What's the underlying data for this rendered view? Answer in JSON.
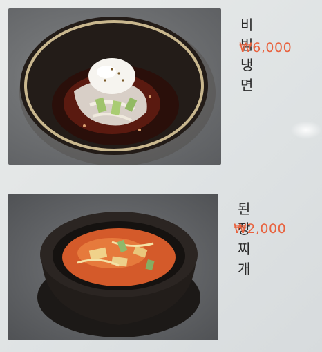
{
  "menu": {
    "items": [
      {
        "name": "비빔냉면",
        "price": "₩6,000",
        "photo_icon": "bibim-naengmyeon-photo"
      },
      {
        "name": "된장찌개",
        "price": "₩2,000",
        "photo_icon": "doenjang-jjigae-photo"
      }
    ]
  },
  "colors": {
    "price": "#e8623e",
    "name": "#2a2a2a",
    "background": "#e4e7e8"
  }
}
